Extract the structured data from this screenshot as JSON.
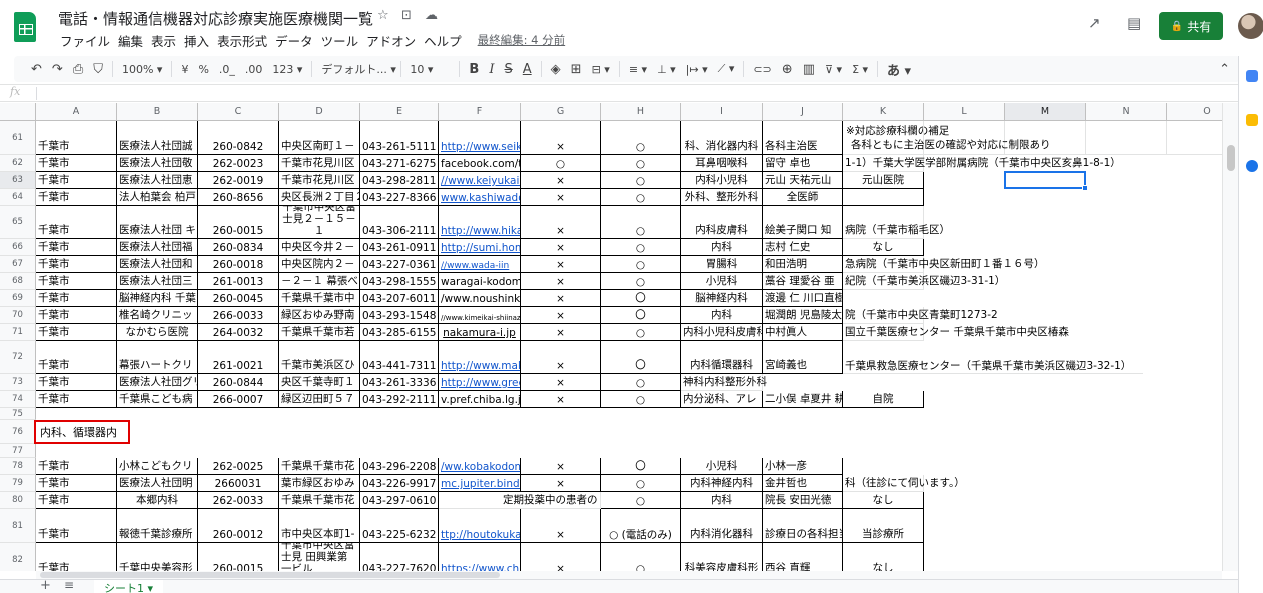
{
  "header": {
    "title": "電話・情報通信機器対応診療実施医療機関一覧",
    "star_icon": "☆",
    "folder_icon": "⊡",
    "cloud_icon": "☁",
    "menu": [
      "ファイル",
      "編集",
      "表示",
      "挿入",
      "表示形式",
      "データ",
      "ツール",
      "アドオン",
      "ヘルプ"
    ],
    "last_edit": "最終編集: 4 分前",
    "trend_icon": "↗",
    "comment_icon": "▤",
    "share_label": "共有",
    "share_icon": "🔒"
  },
  "toolbar": {
    "undo": "↶",
    "redo": "↷",
    "print": "⎙",
    "paint": "⛉",
    "zoom": "100% ▾",
    "currency": "¥",
    "percent": "%",
    "dec_dec": ".0_",
    "dec_inc": ".00",
    "format": "123 ▾",
    "font": "デフォルト... ▾",
    "font_size": "10 ▾",
    "bold": "B",
    "italic": "I",
    "strike": "S",
    "text_color": "A",
    "fill": "◈",
    "borders": "⊞",
    "merge": "⊟ ▾",
    "halign": "≡ ▾",
    "valign": "⊥ ▾",
    "wrap": "|↦ ▾",
    "rotate": "⟋ ▾",
    "link": "⊂⊃",
    "comment": "⊕",
    "chart": "▥",
    "filter": "⊽ ▾",
    "functions": "Σ ▾",
    "ime": "あ ▾",
    "collapse": "⌃"
  },
  "formula_bar": {
    "fx": "fx",
    "value": ""
  },
  "columns": [
    "A",
    "B",
    "C",
    "D",
    "E",
    "F",
    "G",
    "H",
    "I",
    "J",
    "K",
    "L",
    "M",
    "N",
    "O"
  ],
  "rows": [
    {
      "num": "61",
      "cells": [
        "千葉市",
        "医療法人社団誠",
        "260-0842",
        "中央区南町１－",
        "043-261-5111",
        "http://www.seik",
        "×",
        "○",
        "科、消化器内科",
        "各科主治医",
        "※対応診療科欄の補足",
        "各科ともに主治医の確認や対応に制限あり"
      ]
    },
    {
      "num": "62",
      "cells": [
        "千葉市",
        "医療法人社団敬",
        "262-0023",
        "千葉市花見川区",
        "043-271-6275",
        "facebook.com/te",
        "○",
        "○",
        "耳鼻咽喉科",
        "留守 卓也",
        "1-1）千葉大学医学部附属病院（千葉市中央区亥鼻1-8-1）"
      ]
    },
    {
      "num": "63",
      "cells": [
        "千葉市",
        "医療法人社団恵",
        "262-0019",
        "千葉市花見川区",
        "043-298-2811",
        "//www.keiyukai.c",
        "×",
        "○",
        "内科小児科",
        "元山 天祐元山",
        "元山医院"
      ]
    },
    {
      "num": "64",
      "cells": [
        "千葉市",
        "法人柏葉会 柏戸",
        "260-8656",
        "央区長洲２丁目２",
        "043-227-8366",
        "www.kashiwado",
        "×",
        "○",
        "外科、整形外科",
        "全医師"
      ]
    },
    {
      "num": "65",
      "cells": [
        "千葉市",
        "医療法人社団 キ",
        "260-0015",
        "千葉市中央区富士見２－１５－１",
        "043-306-2111",
        "http://www.hika",
        "×",
        "○",
        "内科皮膚科",
        "絵美子関口 知",
        "病院（千葉市稲毛区）"
      ]
    },
    {
      "num": "66",
      "cells": [
        "千葉市",
        "医療法人社団福",
        "260-0834",
        "中央区今井２－",
        "043-261-0911",
        "http://sumi.hom",
        "×",
        "○",
        "内科",
        "志村 仁史",
        "なし"
      ]
    },
    {
      "num": "67",
      "cells": [
        "千葉市",
        "医療法人社団和",
        "260-0018",
        "中央区院内２－",
        "043-227-0361",
        "//www.wada-iin",
        "×",
        "○",
        "胃腸科",
        "和田浩明",
        "急病院（千葉市中央区新田町１番１６号）"
      ]
    },
    {
      "num": "68",
      "cells": [
        "千葉市",
        "医療法人社団三",
        "261-0013",
        "－２－１ 幕張べ",
        "043-298-1555",
        "waragai-kodomo",
        "×",
        "○",
        "小児科",
        "藁谷 理愛谷 亜",
        "紀院（千葉市美浜区磯辺3-31-1）"
      ]
    },
    {
      "num": "69",
      "cells": [
        "千葉市",
        "脳神経内科 千葉",
        "260-0045",
        "千葉県千葉市中",
        "043-207-6011",
        "/www.noushinke",
        "×",
        "〇",
        "脳神経内科",
        "渡邊 仁 川口直樹"
      ]
    },
    {
      "num": "70",
      "cells": [
        "千葉市",
        "椎名崎クリニッ",
        "266-0033",
        "緑区おゆみ野南",
        "043-293-1548",
        "//www.kimeikai-shiinaz",
        "×",
        "〇",
        "内科",
        "堀潤朗 児島陵太",
        "院（千葉市中央区青葉町1273-2"
      ]
    },
    {
      "num": "71",
      "cells": [
        "千葉市",
        "なかむら医院",
        "264-0032",
        "千葉県千葉市若",
        "043-285-6155",
        "nakamura-i.jp",
        "×",
        "○",
        "内科小児科皮膚科",
        "中村眞人",
        "国立千葉医療センター 千葉県千葉市中央区椿森"
      ]
    },
    {
      "num": "72",
      "cells": [
        "千葉市",
        "幕張ハートクリ",
        "261-0021",
        "千葉市美浜区ひ",
        "043-441-7311",
        "http://www.mak",
        "×",
        "〇",
        "内科循環器科",
        "宮崎義也",
        "千葉県救急医療センター（千葉県千葉市美浜区磯辺3-32-1）"
      ]
    },
    {
      "num": "73",
      "cells": [
        "千葉市",
        "医療法人社団グリー",
        "260-0844",
        "央区千葉寺町１",
        "043-261-3336",
        "http://www.gree",
        "×",
        "○",
        "神科内科整形外科"
      ]
    },
    {
      "num": "74",
      "cells": [
        "千葉市",
        "千葉県こども病",
        "266-0007",
        "緑区辺田町５７",
        "043-292-2111",
        "v.pref.chiba.lg.jp",
        "×",
        "○",
        "内分泌科、アレ",
        "二小俣 卓夏井 耕",
        "自院"
      ]
    },
    {
      "num": "75",
      "cells": []
    },
    {
      "num": "76",
      "cells": [
        "内科、循環器内"
      ]
    },
    {
      "num": "77",
      "cells": []
    },
    {
      "num": "78",
      "cells": [
        "千葉市",
        "小林こどもクリ",
        "262-0025",
        "千葉県千葉市花",
        "043-296-2208",
        "/ww.kobakodom",
        "×",
        "〇",
        "小児科",
        "小林一彦"
      ]
    },
    {
      "num": "79",
      "cells": [
        "千葉市",
        "医療法人社団明",
        "2660031",
        "葉市緑区おゆみ",
        "043-226-9917",
        "mc.jupiter.bindcl",
        "×",
        "○",
        "内科神経内科",
        "金井哲也",
        "科（往診にて伺います。）"
      ]
    },
    {
      "num": "80",
      "cells": [
        "千葉市",
        "本郷内科",
        "262-0033",
        "千葉県千葉市花",
        "043-297-0610",
        "定期投薬中の患者の",
        "○",
        "内科",
        "院長 安田光徳",
        "なし"
      ]
    },
    {
      "num": "81",
      "cells": [
        "千葉市",
        "報徳千葉診療所",
        "260-0012",
        "市中央区本町1-",
        "043-225-6232",
        "ttp://houtokukai.",
        "×",
        "○ (電話のみ)",
        "内科消化器科",
        "診療日の各科担当",
        "当診療所"
      ]
    },
    {
      "num": "82",
      "cells": [
        "千葉市",
        "千葉中央美容形",
        "260-0015",
        "千葉市中央区富士見 田興業第一ビル",
        "043-227-7620",
        "https://www.chi",
        "×",
        "○",
        "科美容皮膚科形",
        "西谷 直輝",
        "なし"
      ]
    }
  ],
  "sheet_tabs": {
    "add": "+",
    "list": "≡",
    "active": "シート1 ▾"
  }
}
